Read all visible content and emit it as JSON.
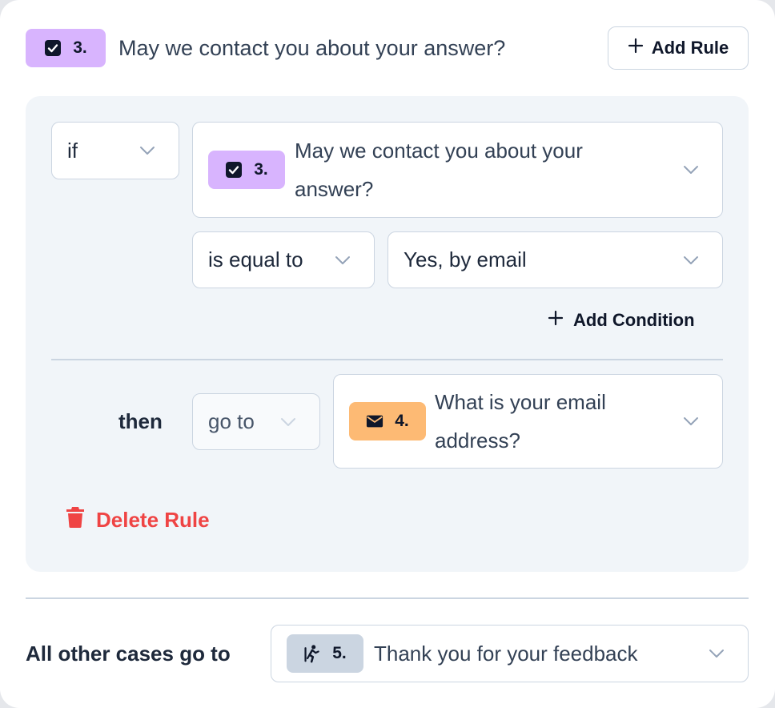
{
  "header": {
    "question_number": "3.",
    "question_title": "May we contact you about your answer?",
    "add_rule_label": "Add Rule"
  },
  "rule": {
    "logic_operator": "if",
    "condition_question_number": "3.",
    "condition_question_line1": "May we contact you about your",
    "condition_question_line2": "answer?",
    "comparator": "is equal to",
    "value": "Yes, by email",
    "add_condition_label": "Add Condition",
    "then_label": "then",
    "action": "go to",
    "target_question_number": "4.",
    "target_question_line1": "What is your email",
    "target_question_line2": "address?",
    "delete_rule_label": "Delete Rule"
  },
  "fallback": {
    "label": "All other cases go to",
    "target_number": "5.",
    "target_title": "Thank you for your feedback"
  },
  "icons": {
    "checkbox": "checkbox-icon",
    "mail": "mail-icon",
    "ending": "runner-icon",
    "plus": "plus-icon",
    "chevron": "chevron-down-icon",
    "trash": "trash-icon"
  },
  "colors": {
    "badge_checkbox": "#d8b4fe",
    "badge_email": "#fdba74",
    "badge_ending": "#cbd5e1",
    "danger": "#ef4444",
    "rule_background": "#f1f5f9"
  }
}
